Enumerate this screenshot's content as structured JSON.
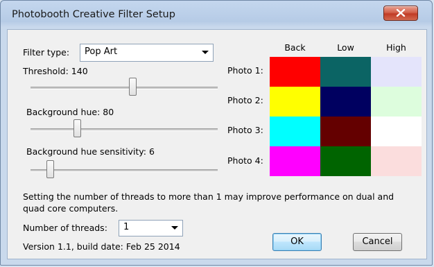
{
  "window": {
    "title": "Photobooth Creative Filter Setup"
  },
  "filter": {
    "label": "Filter type:",
    "value": "Pop Art"
  },
  "sliders": [
    {
      "label": "Threshold: 140",
      "level": 0.55
    },
    {
      "label": "Background hue: 80",
      "level": 0.24
    },
    {
      "label": "Background hue sensitivity: 6",
      "level": 0.09
    }
  ],
  "grid": {
    "columns": [
      "Back",
      "Low",
      "High"
    ],
    "rows": [
      {
        "label": "Photo 1:",
        "colors": [
          "#ff0000",
          "#0b6464",
          "#e4e4fb"
        ]
      },
      {
        "label": "Photo 2:",
        "colors": [
          "#ffff00",
          "#000060",
          "#ddfddd"
        ]
      },
      {
        "label": "Photo 3:",
        "colors": [
          "#00ffff",
          "#640000",
          "#ffffff"
        ]
      },
      {
        "label": "Photo 4:",
        "colors": [
          "#ff00ff",
          "#006400",
          "#fbdddd"
        ]
      }
    ]
  },
  "info": {
    "line1": "Setting the number of threads to more than 1 may improve performance on dual and",
    "line2": "quad core computers."
  },
  "threads": {
    "label": "Number of threads:",
    "value": "1"
  },
  "version": "Version 1.1, build date: Feb 25 2014",
  "buttons": {
    "ok": "OK",
    "cancel": "Cancel"
  }
}
